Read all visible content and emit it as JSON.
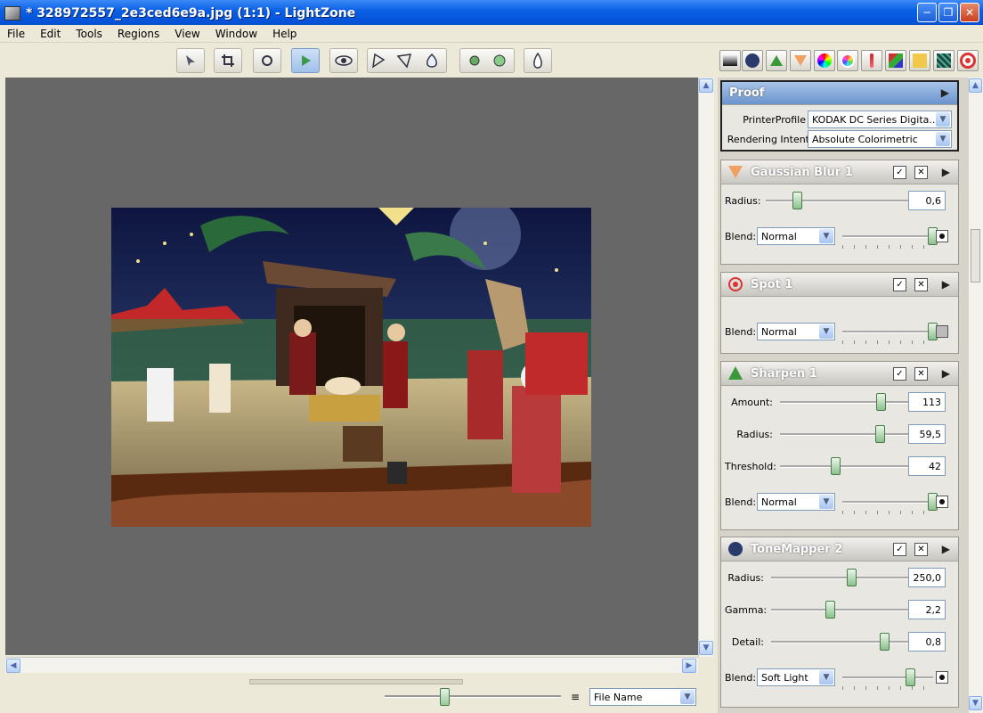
{
  "window": {
    "title": "* 328972557_2e3ced6e9a.jpg (1:1) - LightZone"
  },
  "menu": [
    "File",
    "Edit",
    "Tools",
    "Regions",
    "View",
    "Window",
    "Help"
  ],
  "statusbar": {
    "sort_label": "File Name"
  },
  "proof": {
    "title": "Proof",
    "printer_label": "PrinterProfile",
    "printer_value": "KODAK DC Series Digita...",
    "intent_label": "Rendering Intent",
    "intent_value": "Absolute Colorimetric"
  },
  "panels": {
    "gaussian": {
      "title": "Gaussian Blur 1",
      "radius_label": "Radius:",
      "radius_value": "0,6",
      "blend_label": "Blend:",
      "blend_value": "Normal"
    },
    "spot": {
      "title": "Spot 1",
      "blend_label": "Blend:",
      "blend_value": "Normal"
    },
    "sharpen": {
      "title": "Sharpen 1",
      "amount_label": "Amount:",
      "amount_value": "113",
      "radius_label": "Radius:",
      "radius_value": "59,5",
      "threshold_label": "Threshold:",
      "threshold_value": "42",
      "blend_label": "Blend:",
      "blend_value": "Normal"
    },
    "tonemapper": {
      "title": "ToneMapper 2",
      "radius_label": "Radius:",
      "radius_value": "250,0",
      "gamma_label": "Gamma:",
      "gamma_value": "2,2",
      "detail_label": "Detail:",
      "detail_value": "0,8",
      "blend_label": "Blend:",
      "blend_value": "Soft Light"
    }
  },
  "colors": {
    "titlebar": "#0554d8",
    "proof_header": "#7ea4d4",
    "canvas": "#676767"
  }
}
